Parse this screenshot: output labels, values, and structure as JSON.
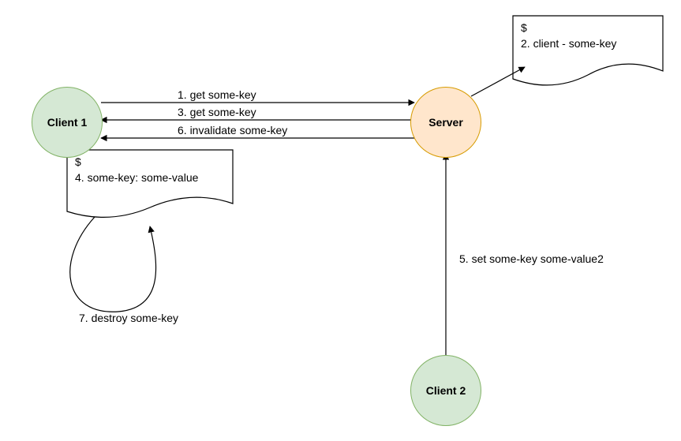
{
  "nodes": {
    "client1": {
      "label": "Client 1"
    },
    "client2": {
      "label": "Client 2"
    },
    "server": {
      "label": "Server"
    }
  },
  "docs": {
    "server_doc": {
      "prompt": "$",
      "line": "2. client  -  some-key"
    },
    "client1_doc": {
      "prompt": "$",
      "line": "4. some-key: some-value"
    }
  },
  "edges": {
    "e1": "1. get some-key",
    "e3": "3. get some-key",
    "e6": "6. invalidate some-key",
    "e5": "5. set some-key some-value2",
    "e7": "7. destroy some-key"
  },
  "colors": {
    "client_fill": "#d5e8d4",
    "client_stroke": "#82b366",
    "server_fill": "#ffe6cc",
    "server_stroke": "#d79b00",
    "line": "#000000"
  }
}
